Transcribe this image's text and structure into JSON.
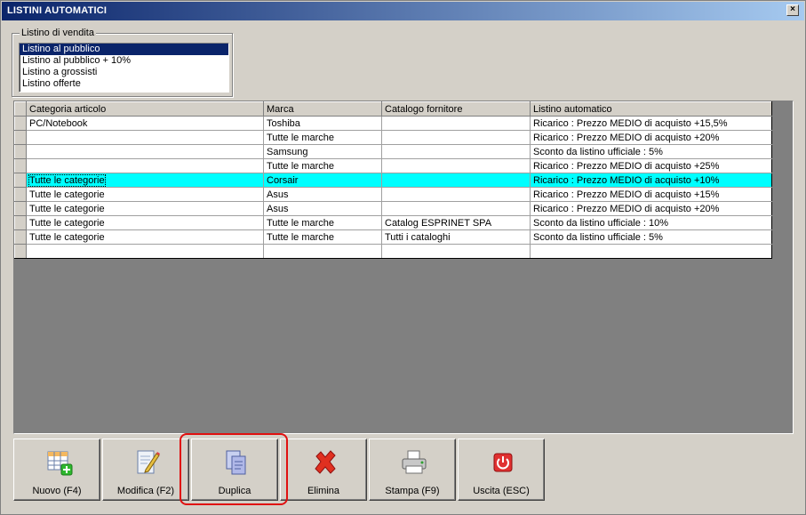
{
  "window": {
    "title": "LISTINI AUTOMATICI",
    "close_glyph": "×"
  },
  "price_list_group": {
    "legend": "Listino di vendita",
    "items": [
      "Listino al pubblico",
      "Listino al pubblico + 10%",
      "Listino a grossisti",
      "Listino offerte"
    ],
    "selected_index": 0
  },
  "grid": {
    "columns": [
      "Categoria articolo",
      "Marca",
      "Catalogo fornitore",
      "Listino automatico"
    ],
    "rows": [
      [
        "PC/Notebook",
        "Toshiba",
        "",
        "Ricarico : Prezzo MEDIO di acquisto +15,5%"
      ],
      [
        "",
        "Tutte le marche",
        "",
        "Ricarico : Prezzo MEDIO di acquisto +20%"
      ],
      [
        "",
        "Samsung",
        "",
        "Sconto da listino ufficiale : 5%"
      ],
      [
        "",
        "Tutte le marche",
        "",
        "Ricarico : Prezzo MEDIO di acquisto +25%"
      ],
      [
        "Tutte le categorie",
        "Corsair",
        "",
        "Ricarico : Prezzo MEDIO di acquisto +10%"
      ],
      [
        "Tutte le categorie",
        "Asus",
        "",
        "Ricarico : Prezzo MEDIO di acquisto +15%"
      ],
      [
        "Tutte le categorie",
        "Asus",
        "",
        "Ricarico : Prezzo MEDIO di acquisto +20%"
      ],
      [
        "Tutte le categorie",
        "Tutte le marche",
        "Catalog ESPRINET SPA",
        "Sconto da listino ufficiale : 10%"
      ],
      [
        "Tutte le categorie",
        "Tutte le marche",
        "Tutti i cataloghi",
        "Sconto da listino ufficiale : 5%"
      ],
      [
        "",
        "",
        "",
        ""
      ]
    ],
    "highlighted_row": 4,
    "highlight_color": "#00ffff"
  },
  "toolbar": {
    "new_label": "Nuovo (F4)",
    "edit_label": "Modifica (F2)",
    "duplicate_label": "Duplica",
    "delete_label": "Elimina",
    "print_label": "Stampa (F9)",
    "exit_label": "Uscita (ESC)"
  },
  "colors": {
    "title_bar": "#0a246a",
    "selection": "#0a246a",
    "annotation_ring": "#e01010"
  }
}
